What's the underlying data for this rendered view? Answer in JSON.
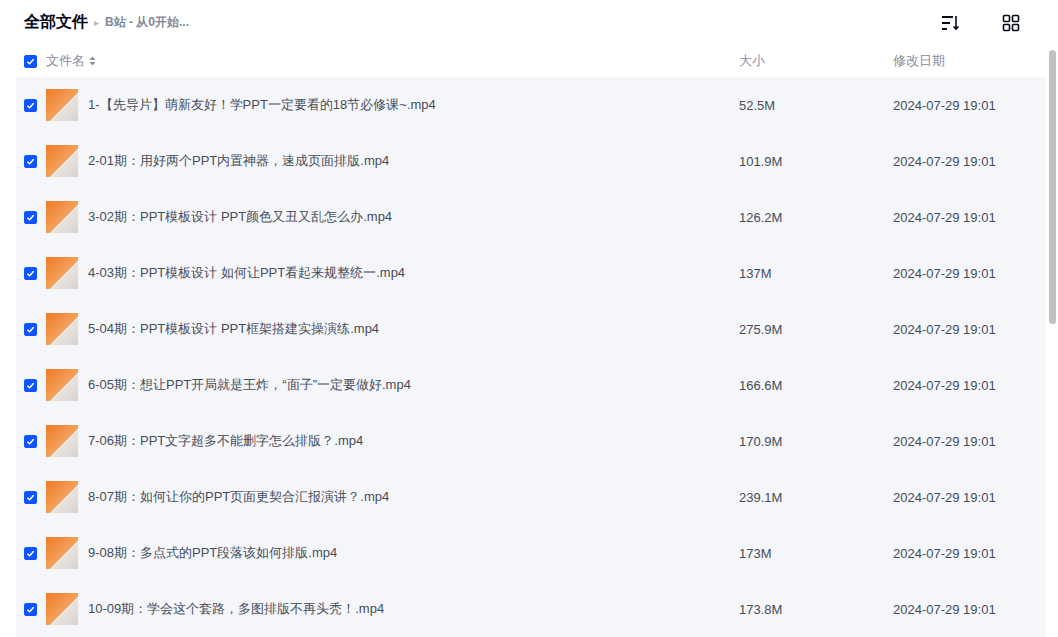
{
  "breadcrumb": {
    "root": "全部文件",
    "separator": "▸",
    "current": "B站 - 从0开始..."
  },
  "table": {
    "all_checked": true,
    "columns": [
      {
        "label": "文件名",
        "sortable": true
      },
      {
        "label": "大小",
        "sortable": false
      },
      {
        "label": "修改日期",
        "sortable": false
      }
    ],
    "rows": [
      {
        "name": "1-【先导片】萌新友好！学PPT一定要看的18节必修课~.mp4",
        "size": "52.5M",
        "date": "2024-07-29 19:01",
        "selected": true
      },
      {
        "name": "2-01期：用好两个PPT内置神器，速成页面排版.mp4",
        "size": "101.9M",
        "date": "2024-07-29 19:01",
        "selected": true
      },
      {
        "name": "3-02期：PPT模板设计 PPT颜色又丑又乱怎么办.mp4",
        "size": "126.2M",
        "date": "2024-07-29 19:01",
        "selected": true
      },
      {
        "name": "4-03期：PPT模板设计 如何让PPT看起来规整统一.mp4",
        "size": "137M",
        "date": "2024-07-29 19:01",
        "selected": true
      },
      {
        "name": "5-04期：PPT模板设计 PPT框架搭建实操演练.mp4",
        "size": "275.9M",
        "date": "2024-07-29 19:01",
        "selected": true
      },
      {
        "name": "6-05期：想让PPT开局就是王炸，“面子”一定要做好.mp4",
        "size": "166.6M",
        "date": "2024-07-29 19:01",
        "selected": true
      },
      {
        "name": "7-06期：PPT文字超多不能删字怎么排版？.mp4",
        "size": "170.9M",
        "date": "2024-07-29 19:01",
        "selected": true
      },
      {
        "name": "8-07期：如何让你的PPT页面更契合汇报演讲？.mp4",
        "size": "239.1M",
        "date": "2024-07-29 19:01",
        "selected": true
      },
      {
        "name": "9-08期：多点式的PPT段落该如何排版.mp4",
        "size": "173M",
        "date": "2024-07-29 19:01",
        "selected": true
      },
      {
        "name": "10-09期：学会这个套路，多图排版不再头秃！.mp4",
        "size": "173.8M",
        "date": "2024-07-29 19:01",
        "selected": true
      }
    ]
  },
  "scrollbar": {
    "level": 0.43
  }
}
